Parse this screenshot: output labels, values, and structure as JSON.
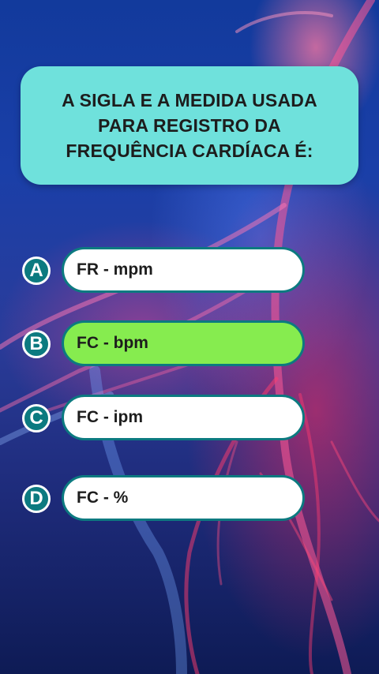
{
  "question": {
    "text": "A SIGLA E A MEDIDA USADA PARA REGISTRO DA FREQUÊNCIA CARDÍACA É:"
  },
  "options": [
    {
      "letter": "A",
      "label": "FR - mpm",
      "highlighted": false
    },
    {
      "letter": "B",
      "label": "FC - bpm",
      "highlighted": true
    },
    {
      "letter": "C",
      "label": "FC - ipm",
      "highlighted": false
    },
    {
      "letter": "D",
      "label": "FC - %",
      "highlighted": false
    }
  ],
  "colors": {
    "card": "#6fe1dc",
    "badge": "#0c7a80",
    "correct": "#86ec4f",
    "option": "#ffffff"
  },
  "background": {
    "icon": "human-nervous-system-illustration"
  }
}
